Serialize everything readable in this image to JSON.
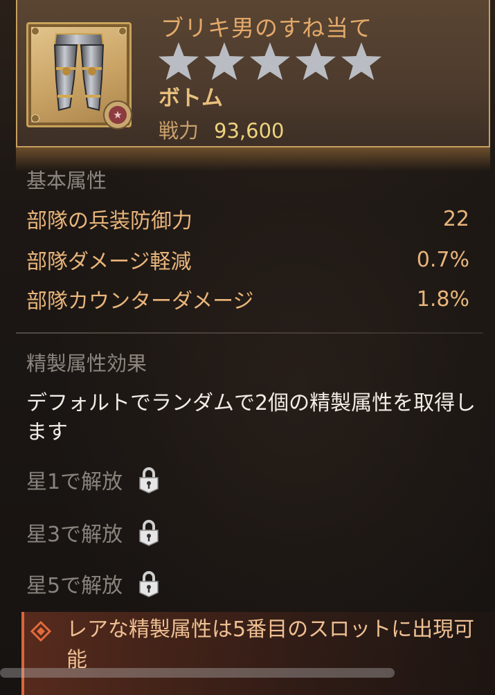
{
  "item": {
    "name": "ブリキ男のすね当て",
    "slot": "ボトム",
    "power_label": "戦力",
    "power_value": "93,600",
    "stars_total": 5,
    "stars_filled": 0,
    "icon": "armored-leg-greaves-icon",
    "class_icon": "star-badge-icon"
  },
  "basic": {
    "title": "基本属性",
    "stats": [
      {
        "label": "部隊の兵装防御力",
        "value": "22"
      },
      {
        "label": "部隊ダメージ軽減",
        "value": "0.7%"
      },
      {
        "label": "部隊カウンターダメージ",
        "value": "1.8%"
      }
    ]
  },
  "refine": {
    "title": "精製属性効果",
    "description": "デフォルトでランダムで2個の精製属性を取得します",
    "unlocks": [
      {
        "label": "星1で解放",
        "icon": "lock-icon"
      },
      {
        "label": "星3で解放",
        "icon": "lock-icon"
      },
      {
        "label": "星5で解放",
        "icon": "lock-icon"
      }
    ]
  },
  "note": {
    "icon": "diamond-bullet-icon",
    "text": "レアな精製属性は5番目のスロットに出現可能"
  },
  "colors": {
    "accent_gold": "#c7a05e",
    "title": "#e3a96a",
    "stat_text": "#e9b57b",
    "star_empty": "#b9bcc2",
    "note_accent": "#d9663d"
  }
}
